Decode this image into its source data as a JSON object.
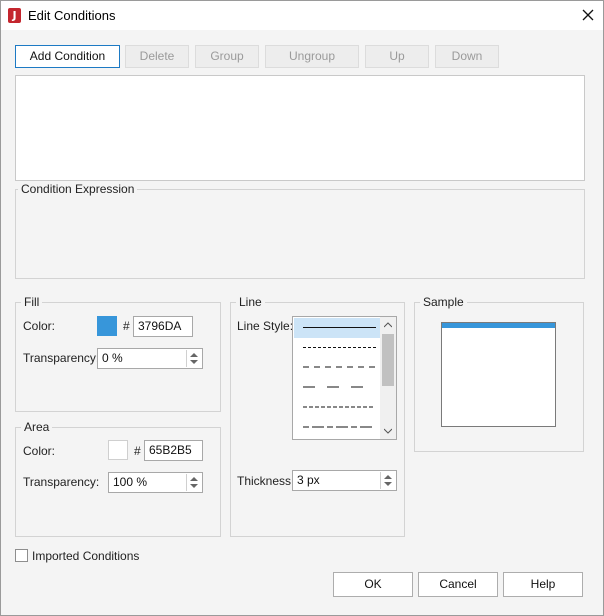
{
  "window": {
    "title": "Edit Conditions",
    "app_icon_letter": "J"
  },
  "toolbar": {
    "add_condition": "Add Condition",
    "delete": "Delete",
    "group": "Group",
    "ungroup": "Ungroup",
    "up": "Up",
    "down": "Down"
  },
  "condition_expression": {
    "legend": "Condition Expression"
  },
  "fill": {
    "legend": "Fill",
    "color_label": "Color:",
    "hash": "#",
    "color_value": "3796DA",
    "color_hex": "#3796DA",
    "transparency_label": "Transparency:",
    "transparency_value": "0 %"
  },
  "area": {
    "legend": "Area",
    "color_label": "Color:",
    "hash": "#",
    "color_value": "65B2B5",
    "color_hex": "#FFFFFF",
    "transparency_label": "Transparency:",
    "transparency_value": "100 %"
  },
  "line": {
    "legend": "Line",
    "style_label": "Line Style:",
    "styles": [
      "solid",
      "dotted",
      "dashed",
      "long-dash",
      "dense-dash",
      "dash-dot"
    ],
    "selected_style": "solid",
    "thickness_label": "Thickness:",
    "thickness_value": "3 px"
  },
  "sample": {
    "legend": "Sample",
    "fill_color": "#3796DA"
  },
  "imported_conditions": {
    "label": "Imported Conditions",
    "checked": false
  },
  "footer": {
    "ok": "OK",
    "cancel": "Cancel",
    "help": "Help"
  },
  "colors": {
    "accent": "#1D7AC4",
    "selection": "#CCE4F7",
    "brand": "#C4262E"
  }
}
